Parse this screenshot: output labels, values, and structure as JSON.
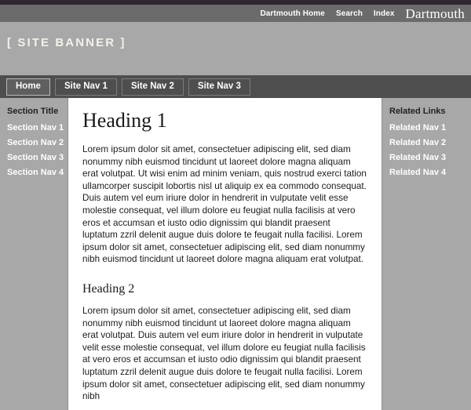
{
  "utility_bar": {
    "links": [
      {
        "label": "Dartmouth Home"
      },
      {
        "label": "Search"
      },
      {
        "label": "Index"
      }
    ],
    "wordmark": "Dartmouth"
  },
  "banner": {
    "text": "[ SITE BANNER ]"
  },
  "primary_nav": {
    "tabs": [
      {
        "label": "Home",
        "active": true
      },
      {
        "label": "Site Nav 1",
        "active": false
      },
      {
        "label": "Site Nav 2",
        "active": false
      },
      {
        "label": "Site Nav 3",
        "active": false
      }
    ]
  },
  "left_sidebar": {
    "title": "Section Title",
    "links": [
      {
        "label": "Section Nav 1"
      },
      {
        "label": "Section Nav 2"
      },
      {
        "label": "Section Nav 3"
      },
      {
        "label": "Section Nav 4"
      }
    ]
  },
  "right_sidebar": {
    "title": "Related Links",
    "links": [
      {
        "label": "Related Nav 1"
      },
      {
        "label": "Related Nav 2"
      },
      {
        "label": "Related Nav 3"
      },
      {
        "label": "Related Nav 4"
      }
    ]
  },
  "main": {
    "heading1": "Heading 1",
    "paragraph1": "Lorem ipsum dolor sit amet, consectetuer adipiscing elit, sed diam nonummy nibh euismod tincidunt ut laoreet dolore magna aliquam erat volutpat. Ut wisi enim ad minim veniam, quis nostrud exerci tation ullamcorper suscipit lobortis nisl ut aliquip ex ea commodo consequat. Duis autem vel eum iriure dolor in hendrerit in vulputate velit esse molestie consequat, vel illum dolore eu feugiat nulla facilisis at vero eros et accumsan et iusto odio dignissim qui blandit praesent luptatum zzril delenit augue duis dolore te feugait nulla facilisi. Lorem ipsum dolor sit amet, consectetuer adipiscing elit, sed diam nonummy nibh euismod tincidunt ut laoreet dolore magna aliquam erat volutpat.",
    "heading2": "Heading 2",
    "paragraph2": "Lorem ipsum dolor sit amet, consectetuer adipiscing elit, sed diam nonummy nibh euismod tincidunt ut laoreet dolore magna aliquam erat volutpat. Duis autem vel eum iriure dolor in hendrerit in vulputate velit esse molestie consequat, vel illum dolore eu feugiat nulla facilisis at vero eros et accumsan et iusto odio dignissim qui blandit praesent luptatum zzril delenit augue duis dolore te feugait nulla facilisi. Lorem ipsum dolor sit amet, consectetuer adipiscing elit, sed diam nonummy nibh"
  }
}
